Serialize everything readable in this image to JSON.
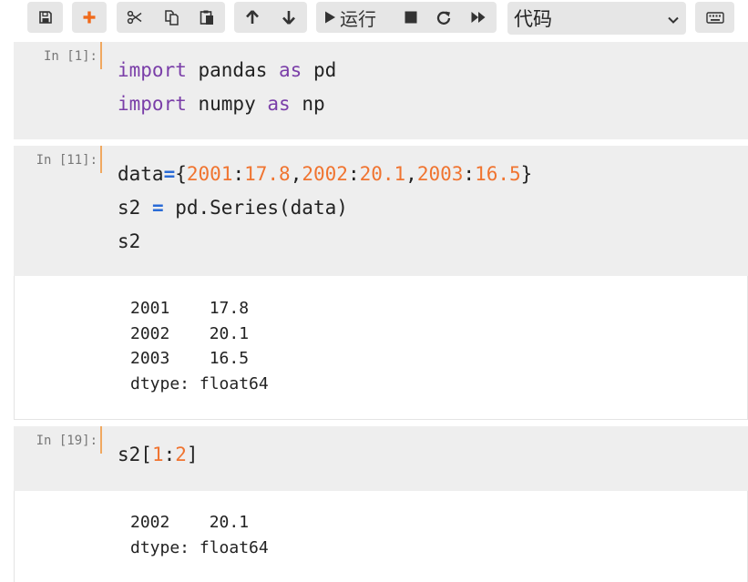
{
  "toolbar": {
    "icons": [
      "save-icon",
      "plus-icon",
      "cut-icon",
      "copy-icon",
      "paste-icon",
      "arrow-up-icon",
      "arrow-down-icon",
      "play-icon",
      "stop-icon",
      "restart-icon",
      "fast-forward-icon",
      "keyboard-icon"
    ],
    "run_label": "运行",
    "cell_type": "代码",
    "accent_color": "#f06a1b"
  },
  "cells": [
    {
      "prompt": "In [1]:",
      "code": [
        [
          {
            "t": "import",
            "c": "kw"
          },
          {
            "t": " pandas "
          },
          {
            "t": "as",
            "c": "kw"
          },
          {
            "t": " pd"
          }
        ],
        [
          {
            "t": "import",
            "c": "kw"
          },
          {
            "t": " numpy "
          },
          {
            "t": "as",
            "c": "kw"
          },
          {
            "t": " np"
          }
        ]
      ],
      "output": []
    },
    {
      "prompt": "In [11]:",
      "code": [
        [
          {
            "t": "data"
          },
          {
            "t": "=",
            "c": "op"
          },
          {
            "t": "{"
          },
          {
            "t": "2001",
            "c": "num"
          },
          {
            "t": ":"
          },
          {
            "t": "17.8",
            "c": "num"
          },
          {
            "t": ","
          },
          {
            "t": "2002",
            "c": "num"
          },
          {
            "t": ":"
          },
          {
            "t": "20.1",
            "c": "num"
          },
          {
            "t": ","
          },
          {
            "t": "2003",
            "c": "num"
          },
          {
            "t": ":"
          },
          {
            "t": "16.5",
            "c": "num"
          },
          {
            "t": "}"
          }
        ],
        [
          {
            "t": "s2 "
          },
          {
            "t": "=",
            "c": "op"
          },
          {
            "t": " pd.Series(data)"
          }
        ],
        [
          {
            "t": "s2"
          }
        ]
      ],
      "output": [
        "2001    17.8",
        "2002    20.1",
        "2003    16.5",
        "dtype: float64"
      ]
    },
    {
      "prompt": "In [19]:",
      "code": [
        [
          {
            "t": "s2["
          },
          {
            "t": "1",
            "c": "num"
          },
          {
            "t": ":"
          },
          {
            "t": "2",
            "c": "num"
          },
          {
            "t": "]"
          }
        ]
      ],
      "output": [
        "2002    20.1",
        "dtype: float64"
      ]
    }
  ]
}
